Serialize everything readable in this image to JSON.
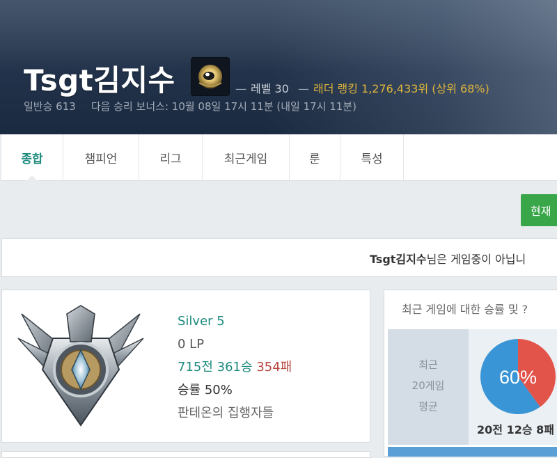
{
  "profile": {
    "name": "Tsgt김지수",
    "icon": "profile-icon-eye-orb",
    "level_text": "레벨 30",
    "ladder_text": "래더 랭킹 1,276,433위 (상위 68%)",
    "normal_wins": "일반승 613",
    "next_bonus": "다음 승리 보너스: 10월 08일 17시 11분 (내일 17시 11분)"
  },
  "tabs": [
    {
      "label": "종합",
      "active": true
    },
    {
      "label": "챔피언",
      "active": false
    },
    {
      "label": "리그",
      "active": false
    },
    {
      "label": "최근게임",
      "active": false
    },
    {
      "label": "룬",
      "active": false
    },
    {
      "label": "특성",
      "active": false
    }
  ],
  "refresh_button": "현재",
  "notice": {
    "name": "Tsgt김지수",
    "suffix": "님은 게임중이 아닙니"
  },
  "rank": {
    "emblem": "silver-tier-emblem",
    "tier": "Silver 5",
    "lp": "0 LP",
    "games": "715전",
    "wins": "361승",
    "losses": "354패",
    "winrate": "승률 50%",
    "league": "판테온의 집행자들"
  },
  "recent": {
    "title": "최근 게임에 대한 승률 및 ?",
    "label_line1": "최근",
    "label_line2": "20게임",
    "label_line3": "평균",
    "winrate_text": "60%",
    "win_fraction": 0.6,
    "summary": "20전 12승 8패",
    "colors": {
      "win": "#3a95d6",
      "loss": "#e2534a"
    }
  }
}
